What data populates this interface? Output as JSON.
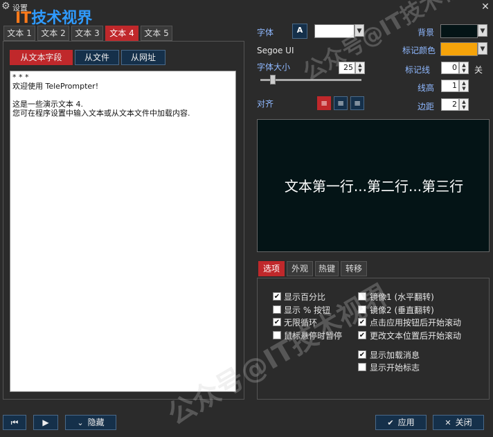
{
  "window": {
    "title": "设置",
    "close": "✕"
  },
  "logo": {
    "it": "IT",
    "text": "技术视界"
  },
  "text_tabs": [
    "文本 1",
    "文本 2",
    "文本 3",
    "文本 4",
    "文本 5"
  ],
  "source_buttons": [
    "从文本字段",
    "从文件",
    "从网址"
  ],
  "text_content": "* * *\n欢迎使用 TelePrompter!\n\n这是一些演示文本 4.\n您可在程序设置中输入文本或从文本文件中加载内容.",
  "font": {
    "label": "字体",
    "icon": "A",
    "name": "Segoe UI",
    "size_label": "字体大小",
    "size": "25",
    "align_label": "对齐"
  },
  "colors": {
    "bg_label": "背景",
    "bg": "#041416",
    "mark_label": "标记颜色",
    "mark": "#f5a30a"
  },
  "spinners": {
    "markline_label": "标记线",
    "markline": "0",
    "markline_unit": "关",
    "lineheight_label": "线高",
    "lineheight": "1",
    "margin_label": "边距",
    "margin": "2"
  },
  "preview_text": "文本第一行...第二行...第三行",
  "option_tabs": [
    "选项",
    "外观",
    "热键",
    "转移"
  ],
  "options_left": [
    {
      "label": "显示百分比",
      "checked": "✔"
    },
    {
      "label": "显示 % 按钮",
      "checked": ""
    },
    {
      "label": "无限循环",
      "checked": "✔"
    },
    {
      "label": "鼠标悬停时暂停",
      "checked": ""
    }
  ],
  "options_right": [
    {
      "label": "镜像1 (水平翻转)",
      "checked": ""
    },
    {
      "label": "镜像2 (垂直翻转)",
      "checked": ""
    },
    {
      "label": "点击应用按钮后开始滚动",
      "checked": "✔"
    },
    {
      "label": "更改文本位置后开始滚动",
      "checked": "✔"
    },
    {
      "label": "显示加载消息",
      "checked": "✔"
    },
    {
      "label": "显示开始标志",
      "checked": ""
    }
  ],
  "bottom": {
    "hide": "隐藏",
    "apply": "应用",
    "close": "关闭"
  },
  "watermark": "公众号@IT技术视界"
}
